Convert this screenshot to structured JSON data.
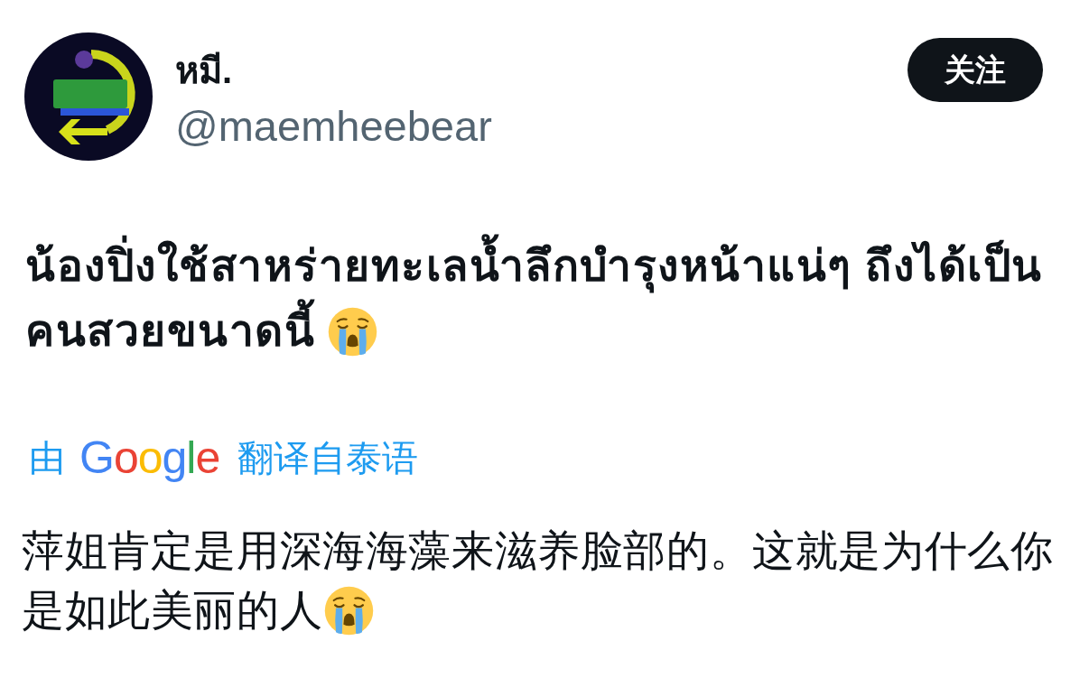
{
  "author": {
    "display_name": "หมี.",
    "handle": "@maemheebear"
  },
  "follow_button": {
    "label": "关注"
  },
  "tweet": {
    "lines": [
      "น้องปิ่งใช้สาหร่ายทะเลน้ำลึกบำรุงหน้าแน่ๆ ถึงได้เป็น",
      "คนสวยขนาดนี้"
    ]
  },
  "translation": {
    "by": "由",
    "provider": "Google",
    "from_language": "翻译自泰语",
    "lines": [
      "萍姐肯定是用深海海藻来滋养脸部的。这就是为什么你",
      "是如此美丽的人"
    ]
  }
}
